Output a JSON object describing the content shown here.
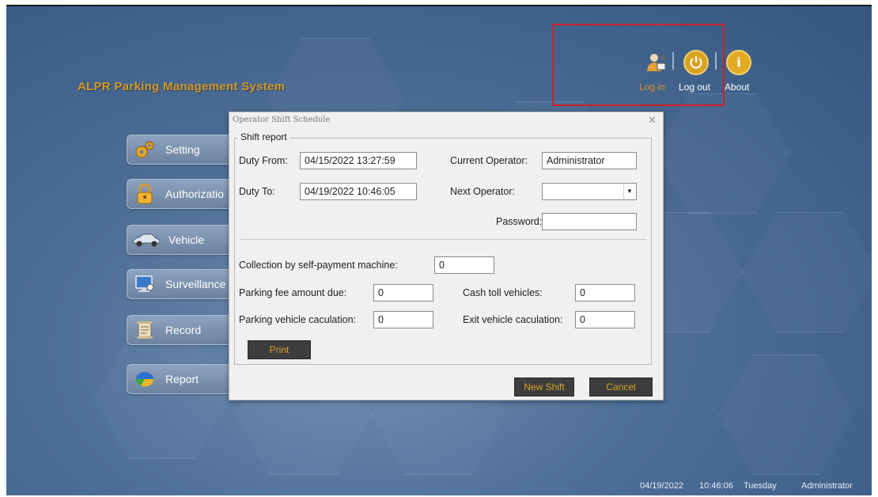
{
  "app": {
    "title": "ALPR Parking Management System"
  },
  "top_bar": {
    "login": "Log in",
    "logout": "Log out",
    "about": "About"
  },
  "menu": [
    {
      "label": "Setting",
      "icon": "gears-icon"
    },
    {
      "label": "Authorizatio",
      "icon": "padlock-icon"
    },
    {
      "label": "Vehicle",
      "icon": "car-icon"
    },
    {
      "label": "Surveillance",
      "icon": "monitor-icon"
    },
    {
      "label": "Record",
      "icon": "scroll-icon"
    },
    {
      "label": "Report",
      "icon": "pie-chart-icon"
    }
  ],
  "dialog": {
    "title": "Operator Shift Schedule",
    "group_title": "Shift report",
    "duty_from_label": "Duty From:",
    "duty_from_value": "04/15/2022 13:27:59",
    "duty_to_label": "Duty To:",
    "duty_to_value": "04/19/2022 10:46:05",
    "current_operator_label": "Current Operator:",
    "current_operator_value": "Administrator",
    "next_operator_label": "Next Operator:",
    "next_operator_value": "",
    "password_label": "Password:",
    "password_value": "",
    "self_payment_label": "Collection by self-payment machine:",
    "self_payment_value": "0",
    "fee_due_label": "Parking fee amount due:",
    "fee_due_value": "0",
    "cash_toll_label": "Cash toll vehicles:",
    "cash_toll_value": "0",
    "parking_calc_label": "Parking vehicle caculation:",
    "parking_calc_value": "0",
    "exit_calc_label": "Exit vehicle caculation:",
    "exit_calc_value": "0",
    "print_button": "Print",
    "new_shift_button": "New Shift",
    "cancel_button": "Cancel"
  },
  "status_bar": {
    "date": "04/19/2022",
    "time": "10:46:06",
    "weekday": "Tuesday",
    "user": "Administrator"
  },
  "colors": {
    "accent_gold": "#d7a326",
    "title_gold": "#d49a2a",
    "highlight_red": "#d0202a",
    "login_orange": "#e08a1e"
  }
}
